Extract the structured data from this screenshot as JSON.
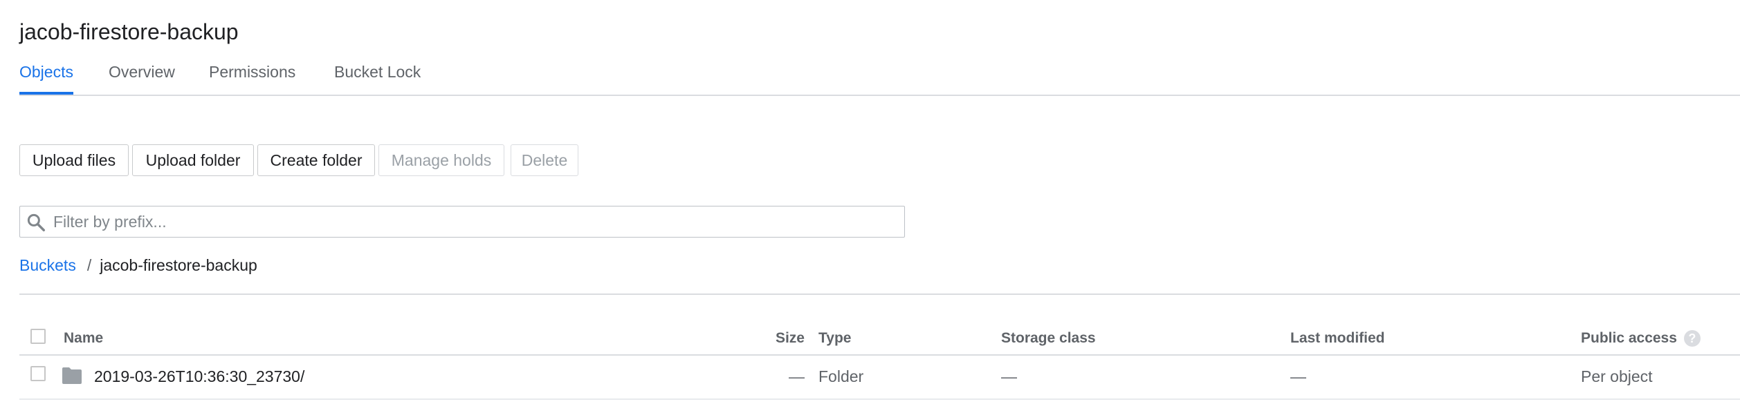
{
  "header": {
    "title": "jacob-firestore-backup"
  },
  "tabs": [
    {
      "label": "Objects",
      "active": true
    },
    {
      "label": "Overview",
      "active": false
    },
    {
      "label": "Permissions",
      "active": false
    },
    {
      "label": "Bucket Lock",
      "active": false
    }
  ],
  "toolbar": {
    "upload_files": "Upload files",
    "upload_folder": "Upload folder",
    "create_folder": "Create folder",
    "manage_holds": "Manage holds",
    "delete": "Delete"
  },
  "filter": {
    "placeholder": "Filter by prefix...",
    "value": ""
  },
  "breadcrumb": {
    "root": "Buckets",
    "separator": "/",
    "current": "jacob-firestore-backup"
  },
  "table": {
    "columns": {
      "name": "Name",
      "size": "Size",
      "type": "Type",
      "storage_class": "Storage class",
      "last_modified": "Last modified",
      "public_access": "Public access"
    },
    "rows": [
      {
        "icon": "folder-icon",
        "name": "2019-03-26T10:36:30_23730/",
        "size": "—",
        "type": "Folder",
        "storage_class": "—",
        "last_modified": "—",
        "public_access": "Per object"
      }
    ]
  },
  "colors": {
    "accent": "#1a73e8",
    "text": "#202124",
    "muted": "#5f6368",
    "border": "#dadce0"
  }
}
